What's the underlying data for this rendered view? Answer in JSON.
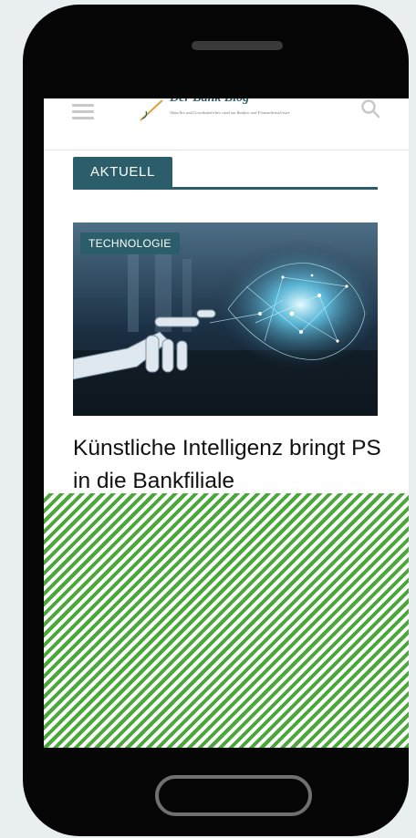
{
  "header": {
    "logo_title": "Der Bank Blog",
    "logo_subtitle": "Aktuelles und Grundsätzliches rund um Banken und Finanzdienstleister",
    "menu_icon": "hamburger-menu-icon",
    "search_icon": "search-icon"
  },
  "section": {
    "label": "AKTUELL"
  },
  "article": {
    "category": "TECHNOLOGIE",
    "title": "Künstliche Intelligenz bringt PS in die Bankfiliale",
    "image": "robot-hand-ai-brain-image"
  },
  "colors": {
    "accent": "#2b5e6a",
    "placeholder_stripe": "#4aa83a",
    "device_frame": "#050505"
  }
}
